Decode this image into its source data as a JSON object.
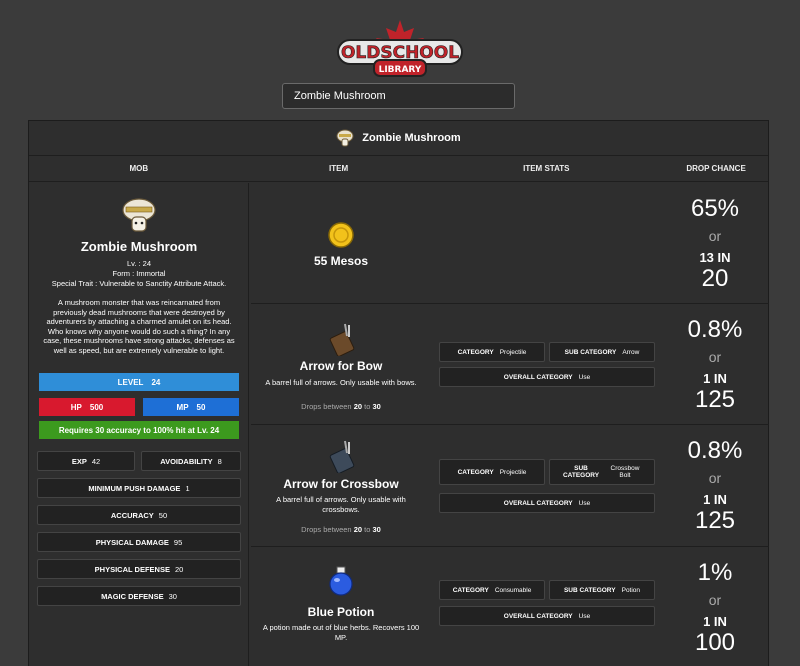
{
  "header": {
    "logo_top": "OLDSCHOOL",
    "logo_bottom": "LIBRARY",
    "search_value": "Zombie Mushroom"
  },
  "panel": {
    "title": "Zombie Mushroom",
    "columns": [
      "MOB",
      "ITEM",
      "ITEM STATS",
      "DROP CHANCE"
    ]
  },
  "mob": {
    "name": "Zombie Mushroom",
    "level_line": "Lv. : 24",
    "form_line": "Form : Immortal",
    "trait_line": "Special Trait : Vulnerable to Sanctity Attribute Attack.",
    "description": "A mushroom monster that was reincarnated from previously dead mushrooms that were destroyed by adventurers by attaching a charmed amulet on its head. Who knows why anyone would do such a thing? In any case, these mushrooms have strong attacks, defenses as well as speed, but are extremely vulnerable to light.",
    "level_label": "LEVEL",
    "level_value": "24",
    "hp_label": "HP",
    "hp_value": "500",
    "mp_label": "MP",
    "mp_value": "50",
    "accuracy_note": "Requires 30 accuracy to 100% hit at Lv. 24",
    "stats": {
      "exp_label": "EXP",
      "exp_value": "42",
      "avoid_label": "AVOIDABILITY",
      "avoid_value": "8",
      "push_label": "MINIMUM PUSH DAMAGE",
      "push_value": "1",
      "acc_label": "ACCURACY",
      "acc_value": "50",
      "pdmg_label": "PHYSICAL DAMAGE",
      "pdmg_value": "95",
      "pdef_label": "PHYSICAL DEFENSE",
      "pdef_value": "20",
      "mdef_label": "MAGIC DEFENSE",
      "mdef_value": "30"
    }
  },
  "drops": [
    {
      "name": "55 Mesos",
      "chance_pct": "65%",
      "or": "or",
      "in_label": "13 IN",
      "in_value": "20"
    },
    {
      "name": "Arrow for Bow",
      "desc": "A barrel full of arrows. Only usable with bows.",
      "drops_prefix": "Drops between",
      "drops_min": "20",
      "drops_to": "to",
      "drops_max": "30",
      "category_label": "CATEGORY",
      "category_value": "Projectile",
      "subcategory_label": "SUB CATEGORY",
      "subcategory_value": "Arrow",
      "overall_label": "OVERALL CATEGORY",
      "overall_value": "Use",
      "chance_pct": "0.8%",
      "or": "or",
      "in_label": "1 IN",
      "in_value": "125"
    },
    {
      "name": "Arrow for Crossbow",
      "desc": "A barrel full of arrows. Only usable with crossbows.",
      "drops_prefix": "Drops between",
      "drops_min": "20",
      "drops_to": "to",
      "drops_max": "30",
      "category_label": "CATEGORY",
      "category_value": "Projectile",
      "subcategory_label": "SUB CATEGORY",
      "subcategory_value": "Crossbow Bolt",
      "overall_label": "OVERALL CATEGORY",
      "overall_value": "Use",
      "chance_pct": "0.8%",
      "or": "or",
      "in_label": "1 IN",
      "in_value": "125"
    },
    {
      "name": "Blue Potion",
      "desc": "A potion made out of blue herbs. Recovers 100 MP.",
      "category_label": "CATEGORY",
      "category_value": "Consumable",
      "subcategory_label": "SUB CATEGORY",
      "subcategory_value": "Potion",
      "overall_label": "OVERALL CATEGORY",
      "overall_value": "Use",
      "chance_pct": "1%",
      "or": "or",
      "in_label": "1 IN",
      "in_value": "100"
    }
  ],
  "colors": {
    "level_bar": "#2f8ed8",
    "hp_bar": "#d8192e",
    "mp_bar": "#1e6fd6",
    "accuracy_bar": "#3c9a1e",
    "background": "#3b3b3b",
    "panel": "#2e2e2e"
  },
  "icons": {
    "logo": "maple-leaf-logo",
    "mob": "zombie-mushroom-icon",
    "mesos": "gold-coin-icon",
    "arrow_bow": "arrow-barrel-icon",
    "arrow_crossbow": "bolt-barrel-icon",
    "potion": "blue-potion-icon"
  }
}
